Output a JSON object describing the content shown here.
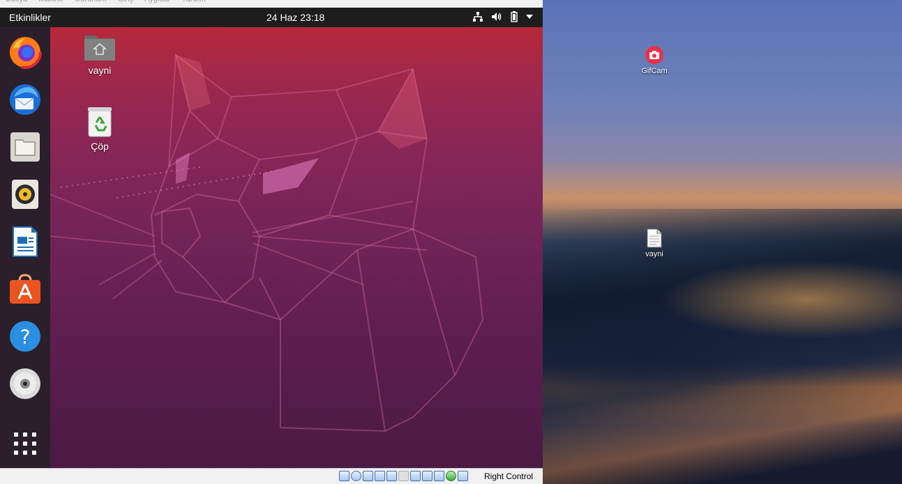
{
  "vm_menubar": {
    "items": [
      "Dosya",
      "Makine",
      "Görünüm",
      "Giriş",
      "Aygıtlar",
      "Yardım"
    ]
  },
  "topbar": {
    "activities_label": "Etkinlikler",
    "clock_text": "24 Haz  23:18",
    "tray_icons": [
      "network-wired-icon",
      "volume-icon",
      "battery-icon",
      "chevron-down-icon"
    ]
  },
  "ubuntu_desktop": {
    "icons": [
      {
        "label": "vayni",
        "icon": "home-folder-icon"
      },
      {
        "label": "Çöp",
        "icon": "trash-icon"
      }
    ]
  },
  "dock": {
    "items": [
      {
        "name": "firefox",
        "icon": "firefox-icon",
        "running": false
      },
      {
        "name": "thunderbird",
        "icon": "thunderbird-icon",
        "running": false
      },
      {
        "name": "files",
        "icon": "files-icon",
        "running": false
      },
      {
        "name": "rhythmbox",
        "icon": "rhythmbox-icon",
        "running": false
      },
      {
        "name": "libreoffice-writer",
        "icon": "writer-icon",
        "running": false
      },
      {
        "name": "ubuntu-software",
        "icon": "software-icon",
        "running": false
      },
      {
        "name": "help",
        "icon": "help-icon",
        "running": false
      },
      {
        "name": "optical-disc",
        "icon": "disc-icon",
        "running": false
      },
      {
        "name": "show-applications",
        "icon": "app-grid-icon",
        "running": false
      }
    ]
  },
  "host_desktop": {
    "icons": [
      {
        "label": "GifCam",
        "icon": "camera-app-icon"
      },
      {
        "label": "vayni",
        "icon": "text-file-icon"
      }
    ]
  },
  "vbox_status": {
    "host_key_label": "Right Control"
  },
  "colors": {
    "ubuntu_orange": "#e95420",
    "topbar_bg": "#1d1d1d",
    "dock_bg": "#2a1f2a"
  }
}
